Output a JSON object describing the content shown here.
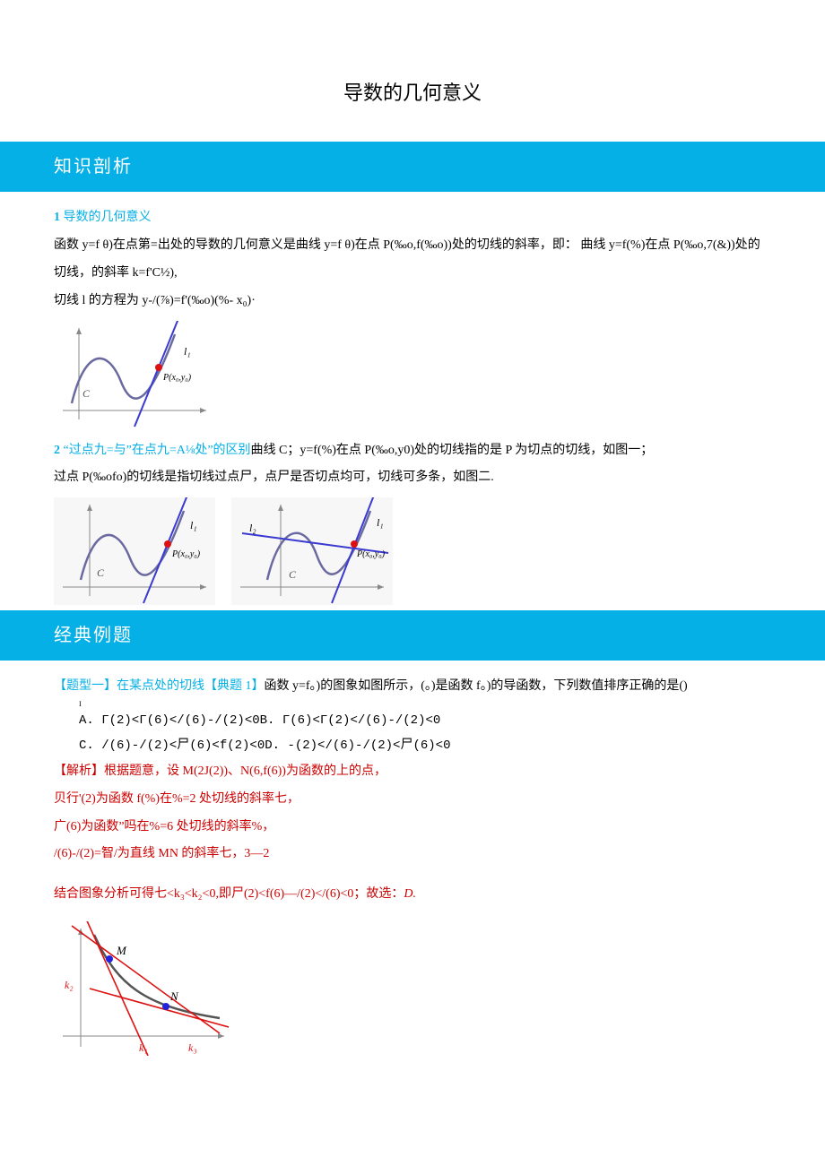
{
  "title": "导数的几何意义",
  "sections": {
    "s1_title": "知识剖析",
    "s2_title": "经典例题"
  },
  "p1": {
    "heading_num": "1",
    "heading_text": "导数的几何意义",
    "line1": "函数 y=f θ)在点第=出处的导数的几何意义是曲线 y=f θ)在点 P(‰o,f(‰o))处的切线的斜率，即： 曲线 y=f(%)在点 P(‰o,7(&))处的切线，的斜率 k=f'C½),",
    "line2": "切线 l 的方程为 y-/(⅞)=f'(‰o)(%- x₀)·"
  },
  "p2": {
    "heading_num": "2",
    "heading_text": "“过点九=与”在点九=A⅛处”的区别",
    "tail": "曲线 C；y=f(%)在点 P(‰o,y0)处的切线指的是 P 为切点的切线，如图一；",
    "line2": "过点 P(‰ofo)的切线是指切线过点尸，点尸是否切点均可，切线可多条，如图二."
  },
  "q1": {
    "tag1": "【题型一】",
    "tag1_text": "在某点处的切线",
    "tag2": "【典题 1】",
    "stem": "函数 y=f。)的图象如图所示，(。)是函数 f。)的导函数，下列数值排序正确的是()",
    "optA": "A. Γ(2)<Γ(6)</(6)-/(2)<0",
    "optB": "B. Γ(6)<Γ(2)</(6)-/(2)<0",
    "optC": "C. /(6)-/(2)<尸(6)<f(2)<0",
    "optD": "D. -(2)</(6)-/(2)<尸(6)<0",
    "ans_tag": "【解析】",
    "ans_l1": "根据题意，设 M(2J(2))、N(6,f(6))为函数的上的点，",
    "ans_l2": "贝行'(2)为函数 f(%)在%=2 处切线的斜率七，",
    "ans_l3": "广(6)为函数”吗在%=6 处切线的斜率%，",
    "ans_l4": "/(6)-/(2)=智/为直线 MN 的斜率七，3—2",
    "ans_l5_a": "结合图象分析可得七<k₃<k₂<0,",
    "ans_l5_b": "即尸(2)<f(6)—/(2)</(6)<0；故选：",
    "ans_l5_c": "D."
  },
  "fig1": {
    "l1": "l₁",
    "P": "P(x₀,y₀)",
    "C": "C"
  },
  "fig2b": {
    "l1": "l₁",
    "l2": "l₂",
    "P": "P(x₀,y₀)",
    "C": "C"
  },
  "fig3": {
    "M": "M",
    "N": "N",
    "k1": "k₁",
    "k2": "k₂",
    "k3": "k₃"
  }
}
